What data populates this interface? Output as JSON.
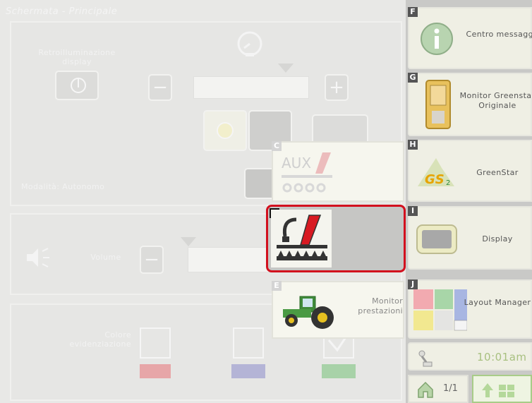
{
  "screen_title": "Schermata - Principale",
  "settings": {
    "backlight_label": "Retroilluminazione display",
    "mode_label": "Modalità: Autonomo",
    "volume_label": "Volume",
    "colour_label": "Colore evidenziazione",
    "minus_label": "−",
    "plus_label": "+"
  },
  "tiles": [
    {
      "letter": "F",
      "label": "Centro messaggi",
      "icon": "info-icon"
    },
    {
      "letter": "G",
      "label": "Monitor Greenstar Originale",
      "icon": "greenstar-monitor-icon"
    },
    {
      "letter": "H",
      "label": "GreenStar",
      "icon": "gs2-logo-icon"
    },
    {
      "letter": "I",
      "label": "Display",
      "icon": "display-icon"
    },
    {
      "letter": "J",
      "label": "Layout Manager",
      "icon": "layout-manager-icon"
    }
  ],
  "status": {
    "time": "10:01am",
    "page": "1/1"
  },
  "popup": {
    "aux_text": "AUX",
    "items": [
      {
        "letter": "C",
        "icon": "aux-implement-icon"
      },
      {
        "letter": "D",
        "icon": "seeder-icon",
        "selected": true
      },
      {
        "letter": "E",
        "label": "Monitor prestazioni",
        "icon": "tractor-icon"
      }
    ]
  },
  "colors": {
    "selection_border": "#d2101e",
    "highlight_red": "#e7a6a8",
    "highlight_blue": "#b4b4d6",
    "highlight_green": "#a8d2a8"
  }
}
